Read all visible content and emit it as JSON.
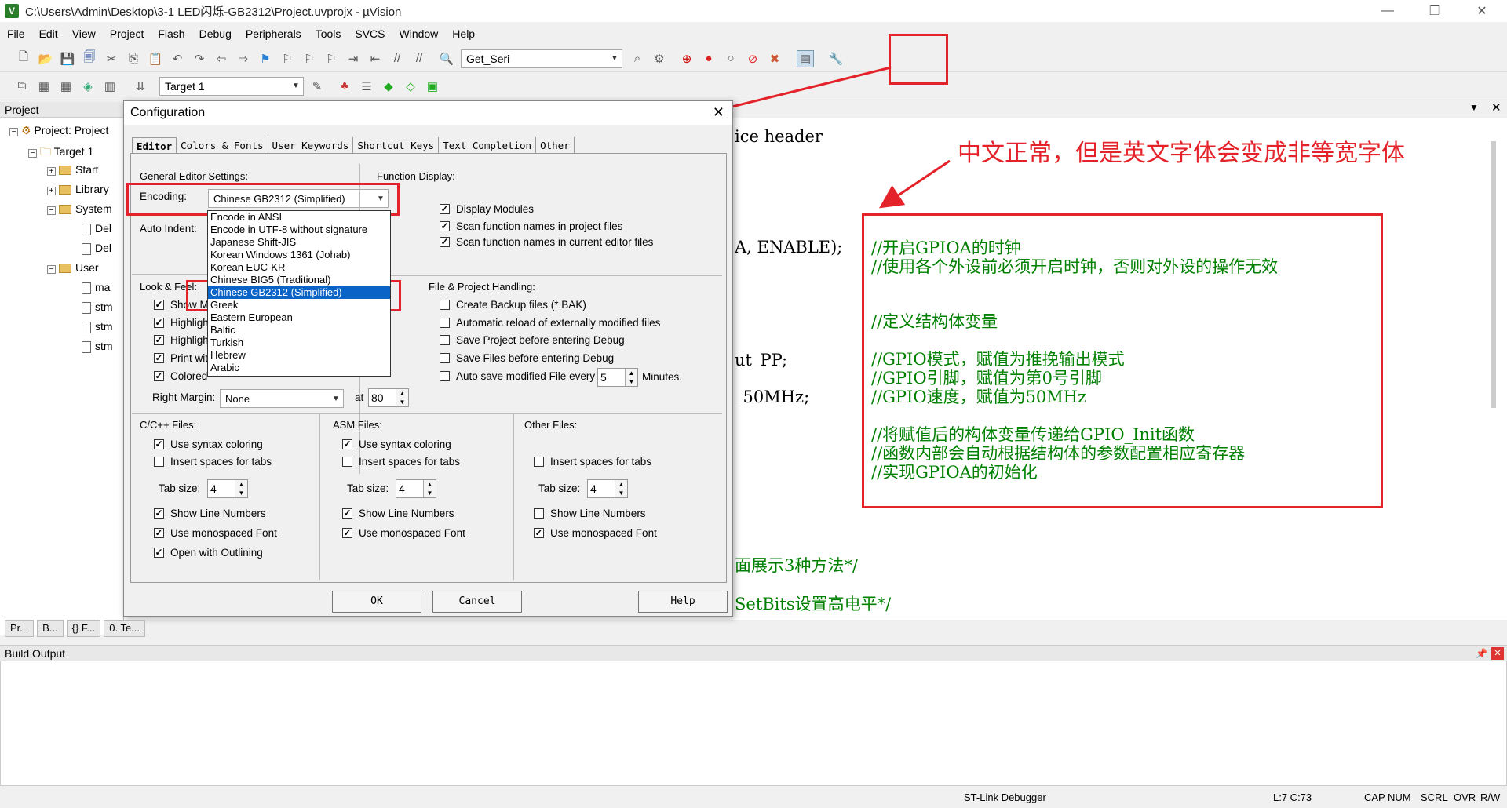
{
  "window": {
    "title": "C:\\Users\\Admin\\Desktop\\3-1 LED闪烁-GB2312\\Project.uvprojx - µVision"
  },
  "menu": [
    "File",
    "Edit",
    "View",
    "Project",
    "Flash",
    "Debug",
    "Peripherals",
    "Tools",
    "SVCS",
    "Window",
    "Help"
  ],
  "toolbar": {
    "find_combo": "Get_Seri",
    "target_combo": "Target 1"
  },
  "project": {
    "header": "Project",
    "root": "Project: Project",
    "target": "Target 1",
    "groups": [
      "Start",
      "Library",
      "System",
      "User"
    ],
    "files": [
      "Del",
      "Del",
      "ma",
      "stm",
      "stm",
      "stm"
    ]
  },
  "code": {
    "line1": "ice header",
    "line2": "A, ENABLE);",
    "line3": "ut_PP;",
    "line4": "_50MHz;",
    "line5": "面展示3种方法*/",
    "line6": "SetBits设置高电平*/",
    "comments": [
      "//开启GPIOA的时钟",
      "//使用各个外设前必须开启时钟，否则对外设的操作无效",
      "//定义结构体变量",
      "//GPIO模式，赋值为推挽输出模式",
      "//GPIO引脚，赋值为第0号引脚",
      "//GPIO速度，赋值为50MHz",
      "//将赋值后的构体变量传递给GPIO_Init函数",
      "//函数内部会自动根据结构体的参数配置相应寄存器",
      "//实现GPIOA的初始化"
    ]
  },
  "annotation": "中文正常，但是英文字体会变成非等宽字体",
  "dialog": {
    "title": "Configuration",
    "tabs": [
      "Editor",
      "Colors & Fonts",
      "User Keywords",
      "Shortcut Keys",
      "Text Completion",
      "Other"
    ],
    "general_label": "General Editor Settings:",
    "encoding_label": "Encoding:",
    "encoding_value": "Chinese GB2312 (Simplified)",
    "auto_indent_label": "Auto Indent:",
    "encoding_options": [
      "Encode in ANSI",
      "Encode in UTF-8 without signature",
      "Japanese Shift-JIS",
      "Korean Windows 1361 (Johab)",
      "Korean EUC-KR",
      "Chinese BIG5 (Traditional)",
      "Chinese GB2312 (Simplified)",
      "Greek",
      "Eastern European",
      "Baltic",
      "Turkish",
      "Hebrew",
      "Arabic"
    ],
    "function_display_label": "Function Display:",
    "fd_options": [
      "Display Modules",
      "Scan function names in project files",
      "Scan function names in current editor files"
    ],
    "look_feel_label": "Look & Feel:",
    "lf_options": [
      "Show M",
      "Highligh",
      "Highligh",
      "Print wit",
      "Colored"
    ],
    "right_margin_label": "Right Margin:",
    "right_margin_value": "None",
    "at_label": "at",
    "at_value": "80",
    "fph_label": "File & Project Handling:",
    "fph_options": [
      "Create Backup files (*.BAK)",
      "Automatic reload of externally modified files",
      "Save Project before entering Debug",
      "Save Files before entering Debug",
      "Auto save modified File every"
    ],
    "autosave_value": "5",
    "minutes_label": "Minutes.",
    "c_label": "C/C++ Files:",
    "asm_label": "ASM Files:",
    "other_label": "Other Files:",
    "syntax": "Use syntax coloring",
    "spaces": "Insert spaces for tabs",
    "tabsize": "Tab size:",
    "tabsize_value": "4",
    "linenums": "Show Line Numbers",
    "mono": "Use monospaced Font",
    "outlining": "Open with Outlining",
    "ok": "OK",
    "cancel": "Cancel",
    "help": "Help"
  },
  "bottom_tabs": [
    "Pr...",
    "B...",
    "{} F...",
    "0. Te..."
  ],
  "build_output": "Build Output",
  "status": {
    "debugger": "ST-Link Debugger",
    "position": "L:7 C:73",
    "cap": "CAP",
    "num": "NUM",
    "scrl": "SCRL",
    "ovr": "OVR",
    "rw": "R/W"
  }
}
